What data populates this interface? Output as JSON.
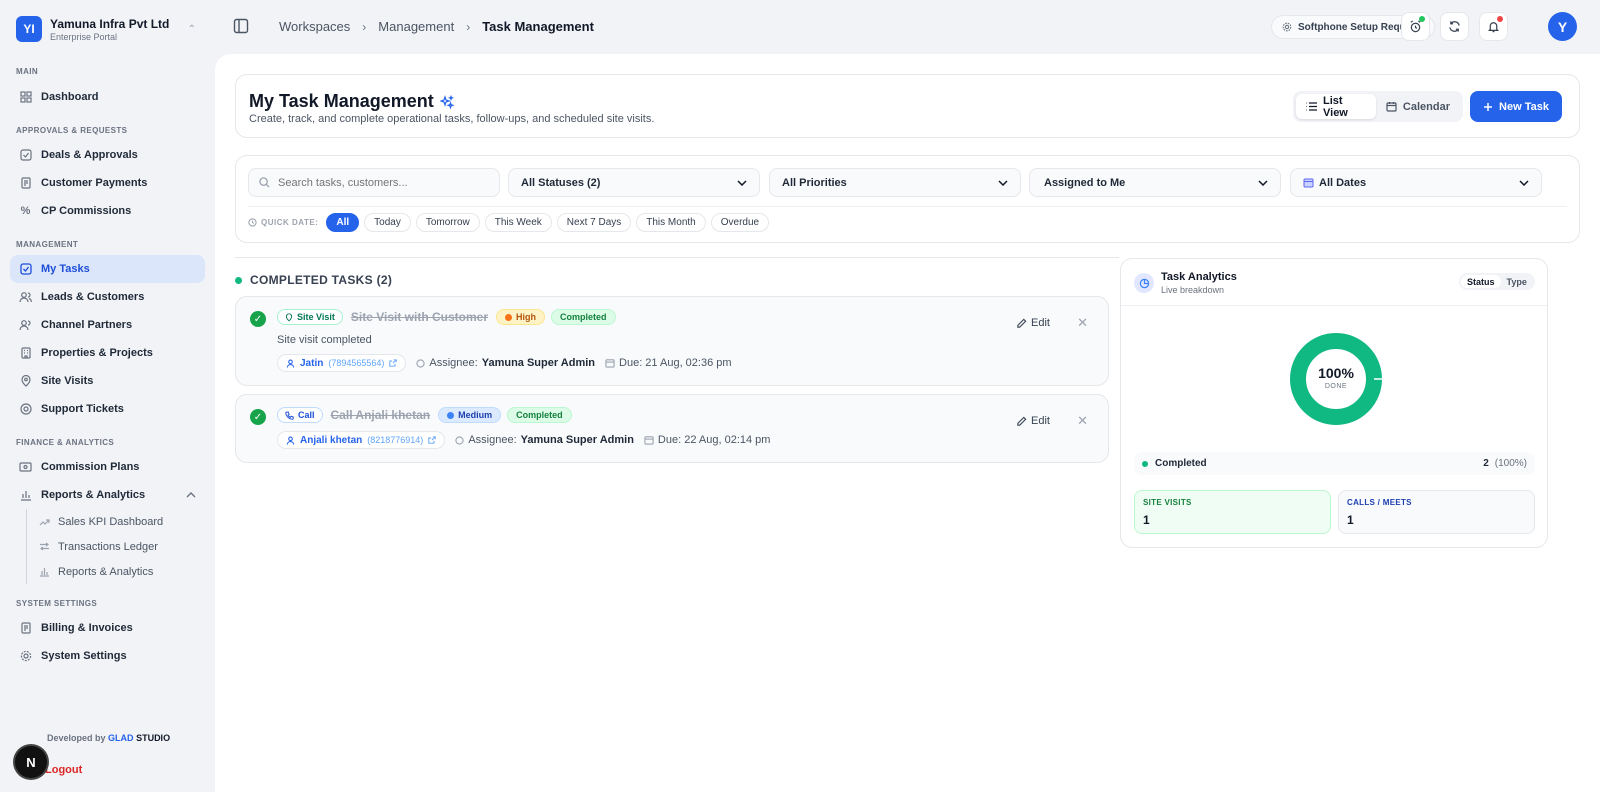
{
  "brand": {
    "initials": "YI",
    "name": "Yamuna Infra Pvt Ltd",
    "subtitle": "Enterprise Portal"
  },
  "sidebar": {
    "sections": {
      "main": "MAIN",
      "approvals": "APPROVALS & REQUESTS",
      "management": "MANAGEMENT",
      "finance": "FINANCE & ANALYTICS",
      "system": "SYSTEM SETTINGS"
    },
    "items": {
      "dashboard": "Dashboard",
      "deals": "Deals & Approvals",
      "payments": "Customer Payments",
      "cp_commissions": "CP Commissions",
      "my_tasks": "My Tasks",
      "leads": "Leads & Customers",
      "channel": "Channel Partners",
      "properties": "Properties & Projects",
      "site_visits": "Site Visits",
      "support": "Support Tickets",
      "commission_plans": "Commission Plans",
      "reports": "Reports & Analytics",
      "sub_sales_kpi": "Sales KPI Dashboard",
      "sub_ledger": "Transactions Ledger",
      "sub_reports": "Reports & Analytics",
      "billing": "Billing & Invoices",
      "settings": "System Settings"
    },
    "footer": {
      "developed_by": "Developed by",
      "glad": "GLAD",
      "studio": "STUDIO",
      "logout": "Logout",
      "badge": "N"
    }
  },
  "topbar": {
    "breadcrumbs": [
      "Workspaces",
      "Management",
      "Task Management"
    ],
    "softphone": "Softphone Setup Required",
    "avatar": "Y"
  },
  "header": {
    "title": "My Task Management",
    "subtitle": "Create, track, and complete operational tasks, follow-ups, and scheduled site visits.",
    "view_list": "List View",
    "view_calendar": "Calendar",
    "new_task": "New Task"
  },
  "filters": {
    "search_placeholder": "Search tasks, customers...",
    "status": "All Statuses (2)",
    "priority": "All Priorities",
    "assigned": "Assigned to Me",
    "dates": "All Dates",
    "quick_label": "QUICK DATE:",
    "quick": [
      "All",
      "Today",
      "Tomorrow",
      "This Week",
      "Next 7 Days",
      "This Month",
      "Overdue"
    ]
  },
  "completed_section": "COMPLETED TASKS (2)",
  "tasks": [
    {
      "type": "Site Visit",
      "title": "Site Visit with Customer",
      "priority": "High",
      "status": "Completed",
      "description": "Site visit completed",
      "customer": "Jatin",
      "phone": "(7894565564)",
      "assignee_label": "Assignee:",
      "assignee": "Yamuna Super Admin",
      "due": "Due: 21 Aug, 02:36 pm",
      "edit": "Edit"
    },
    {
      "type": "Call",
      "title": "Call Anjali khetan",
      "priority": "Medium",
      "status": "Completed",
      "customer": "Anjali khetan",
      "phone": "(8218776914)",
      "assignee_label": "Assignee:",
      "assignee": "Yamuna Super Admin",
      "due": "Due: 22 Aug, 02:14 pm",
      "edit": "Edit"
    }
  ],
  "analytics": {
    "title": "Task Analytics",
    "subtitle": "Live breakdown",
    "toggle_status": "Status",
    "toggle_type": "Type",
    "percent": "100%",
    "percent_value": 100,
    "done_label": "DONE",
    "legend_label": "Completed",
    "legend_value": "2",
    "legend_pct": "(100%)",
    "site_visits_label": "SITE VISITS",
    "site_visits_value": "1",
    "calls_label": "CALLS / MEETS",
    "calls_value": "1",
    "accent_color": "#10b981"
  },
  "colors": {
    "primary": "#2563eb",
    "success": "#16a34a"
  }
}
